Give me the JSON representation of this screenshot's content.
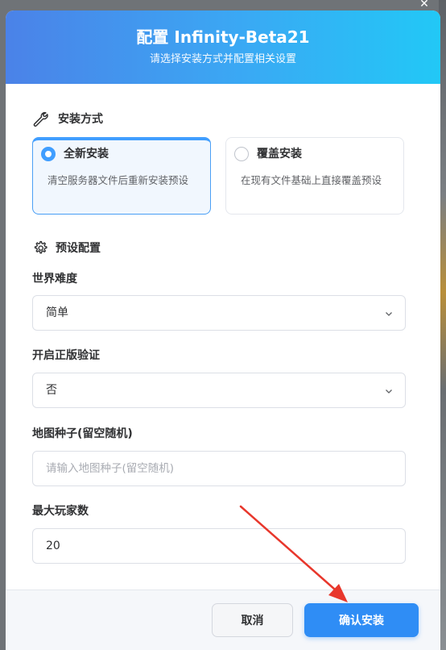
{
  "header": {
    "title": "配置 Infinity-Beta21",
    "subtitle": "请选择安装方式并配置相关设置"
  },
  "install_mode": {
    "section_title": "安装方式",
    "options": [
      {
        "title": "全新安装",
        "desc": "清空服务器文件后重新安装预设",
        "selected": true
      },
      {
        "title": "覆盖安装",
        "desc": "在现有文件基础上直接覆盖预设",
        "selected": false
      }
    ]
  },
  "preset": {
    "section_title": "预设配置",
    "difficulty": {
      "label": "世界难度",
      "value": "简单"
    },
    "online_mode": {
      "label": "开启正版验证",
      "value": "否"
    },
    "seed": {
      "label": "地图种子(留空随机)",
      "value": "",
      "placeholder": "请输入地图种子(留空随机)"
    },
    "max_players": {
      "label": "最大玩家数",
      "value": "20"
    }
  },
  "footer": {
    "cancel_label": "取消",
    "confirm_label": "确认安装"
  },
  "colors": {
    "accent": "#409eff",
    "header_gradient_start": "#4b82e8",
    "header_gradient_end": "#22c8f6",
    "annotation_arrow": "#e8372c"
  },
  "icons": {
    "window_close": "close-icon",
    "install_mode": "wrench-icon",
    "preset": "gear-icon",
    "select": "chevron-down-icon"
  }
}
